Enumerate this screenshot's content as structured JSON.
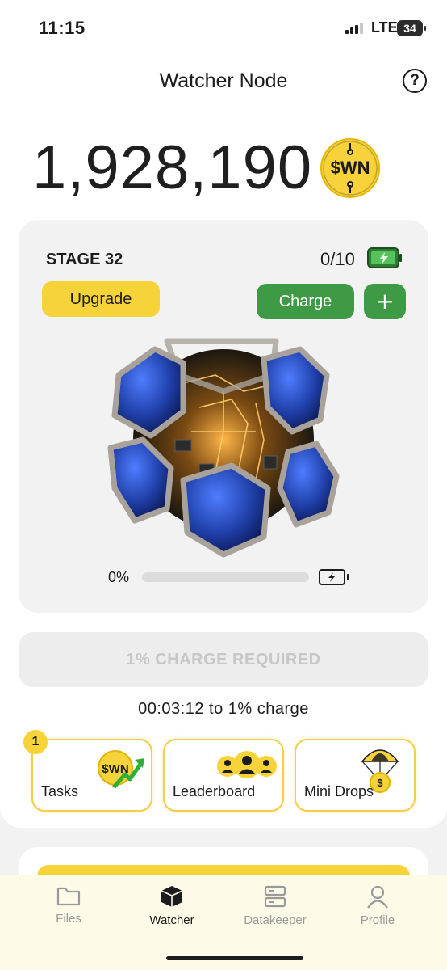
{
  "status_bar": {
    "time": "11:15",
    "network": "LTE",
    "battery": "34"
  },
  "header": {
    "title": "Watcher Node",
    "help_icon": "question-circle-icon"
  },
  "balance": {
    "amount": "1,928,190",
    "token": "$WN"
  },
  "stage": {
    "label": "STAGE 32",
    "charges": "0/10",
    "upgrade_label": "Upgrade",
    "charge_label": "Charge",
    "add_label": "+",
    "progress_text": "0%",
    "progress_fraction": 0
  },
  "charge_required": "1% CHARGE REQUIRED",
  "timer": "00:03:12 to 1% charge",
  "tiles": [
    {
      "label": "Tasks",
      "badge": "1",
      "icon": "wn-coin-up-arrow-icon",
      "coin_text": "$WN"
    },
    {
      "label": "Leaderboard",
      "icon": "users-group-icon"
    },
    {
      "label": "Mini Drops",
      "icon": "parachute-coin-icon",
      "coin_text": "$"
    }
  ],
  "tabs": [
    {
      "label": "Files",
      "icon": "folder-icon"
    },
    {
      "label": "Watcher",
      "icon": "cube-icon",
      "active": true
    },
    {
      "label": "Datakeeper",
      "icon": "server-icon"
    },
    {
      "label": "Profile",
      "icon": "user-icon"
    }
  ],
  "colors": {
    "accent_yellow": "#f7d33a",
    "accent_green": "#3e9a45",
    "tab_bar_bg": "#fdfbe8",
    "node_blue": "#1f3fa8"
  }
}
